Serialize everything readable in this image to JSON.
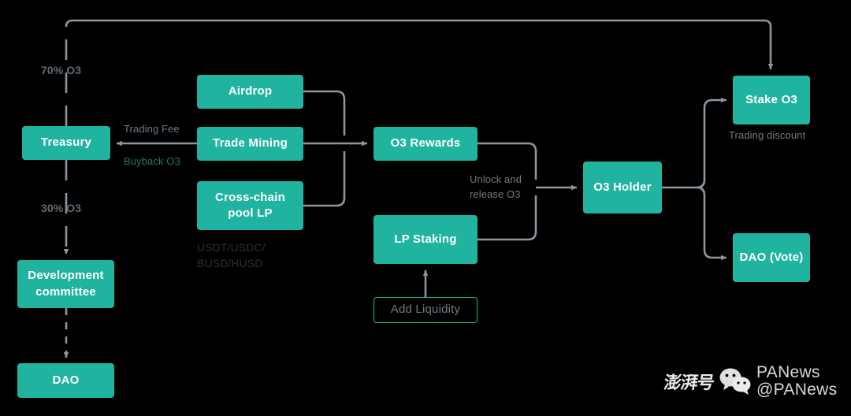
{
  "diagram": {
    "title": "O3 Token Flow Diagram",
    "accent_color": "#1fb3a0",
    "line_color": "#8b96a0",
    "background_color": "#000000",
    "nodes": {
      "treasury": "Treasury",
      "airdrop": "Airdrop",
      "trade_mining": "Trade Mining",
      "cross_chain_pool_lp": "Cross-chain\npool LP",
      "o3_rewards": "O3 Rewards",
      "lp_staking": "LP Staking",
      "add_liquidity": "Add Liquidity",
      "o3_holder": "O3\nHolder",
      "stake_o3": "Stake O3",
      "dao_vote": "DAO (Vote)",
      "development_committee": "Development\ncommittee",
      "dao": "DAO"
    },
    "edge_labels": {
      "seventy_percent": "70% O3",
      "thirty_percent": "30% O3",
      "trading_fee": "Trading Fee",
      "buyback_o3": "Buyback O3",
      "unlock_release": "Unlock and\nrelease O3",
      "trading_discount": "Trading discount",
      "stablecoins": "USDT/USDC/\nBUSD/HUSD"
    }
  },
  "watermark": {
    "cn_badge": "澎湃号",
    "line1": "PANews",
    "line2": "@PANews",
    "icon": "wechat-icon"
  }
}
